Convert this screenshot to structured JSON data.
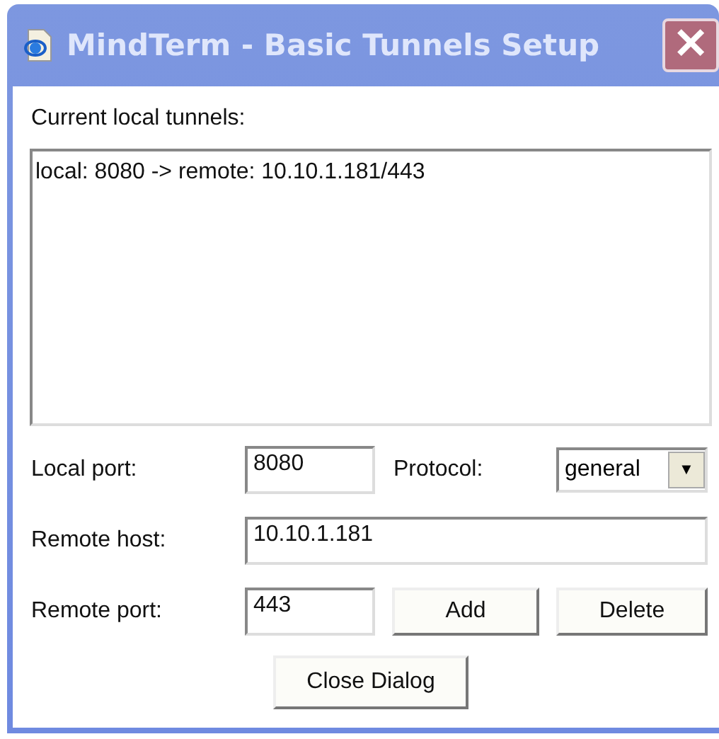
{
  "window": {
    "title": "MindTerm - Basic Tunnels Setup",
    "close": "✕"
  },
  "tunnels_label": "Current local tunnels:",
  "tunnels": [
    {
      "text": "local: 8080 -> remote: 10.10.1.181/443",
      "selected": false
    }
  ],
  "local_port": {
    "label": "Local port:",
    "value": "8080"
  },
  "protocol": {
    "label": "Protocol:",
    "value": "general",
    "arrow": "▼"
  },
  "remote_host": {
    "label": "Remote host:",
    "value": "10.10.1.181"
  },
  "remote_port": {
    "label": "Remote port:",
    "value": "443"
  },
  "buttons": {
    "add": "Add",
    "delete": "Delete",
    "close": "Close Dialog"
  }
}
